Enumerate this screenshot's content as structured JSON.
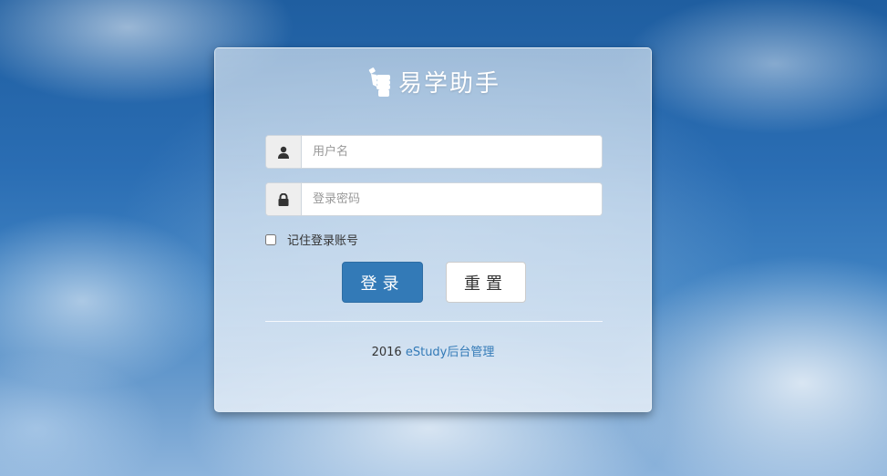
{
  "brand": {
    "icon": "fist-icon",
    "title": "易学助手"
  },
  "form": {
    "username": {
      "icon": "user-icon",
      "placeholder": "用户名",
      "value": ""
    },
    "password": {
      "icon": "lock-icon",
      "placeholder": "登录密码",
      "value": ""
    },
    "remember_label": "记住登录账号",
    "remember_checked": false,
    "login_label": "登录",
    "reset_label": "重置"
  },
  "footer": {
    "year": "2016",
    "link_text": "eStudy后台管理"
  },
  "colors": {
    "primary": "#337ab7",
    "panel": "#d2e1f0",
    "brand_text": "#ffffff"
  }
}
